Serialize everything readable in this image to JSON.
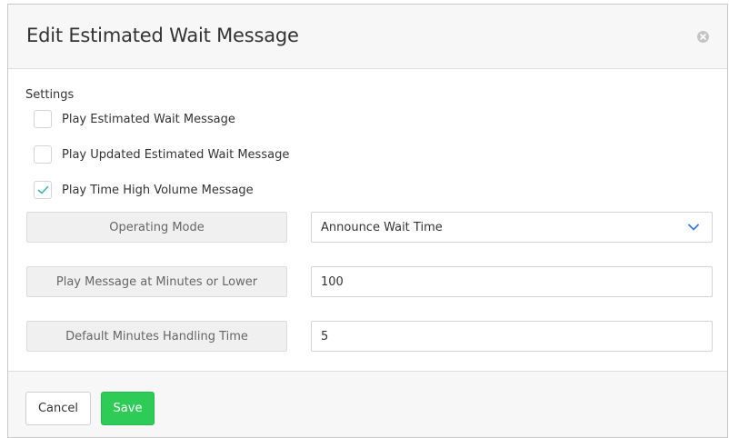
{
  "dialog": {
    "title": "Edit Estimated Wait Message",
    "close_icon": "close-circle-icon"
  },
  "settings": {
    "section_label": "Settings",
    "checkboxes": [
      {
        "label": "Play Estimated Wait Message",
        "checked": false
      },
      {
        "label": "Play Updated Estimated Wait Message",
        "checked": false
      },
      {
        "label": "Play Time High Volume Message",
        "checked": true
      }
    ]
  },
  "fields": {
    "operating_mode": {
      "label": "Operating Mode",
      "value": "Announce Wait Time"
    },
    "play_message_minutes": {
      "label": "Play Message at Minutes or Lower",
      "value": "100"
    },
    "default_minutes_handling": {
      "label": "Default Minutes Handling Time",
      "value": "5"
    }
  },
  "footer": {
    "cancel_label": "Cancel",
    "save_label": "Save"
  },
  "colors": {
    "save_button": "#2ecc56",
    "checkmark": "#3ab4b4",
    "chevron": "#3a7bd5"
  }
}
